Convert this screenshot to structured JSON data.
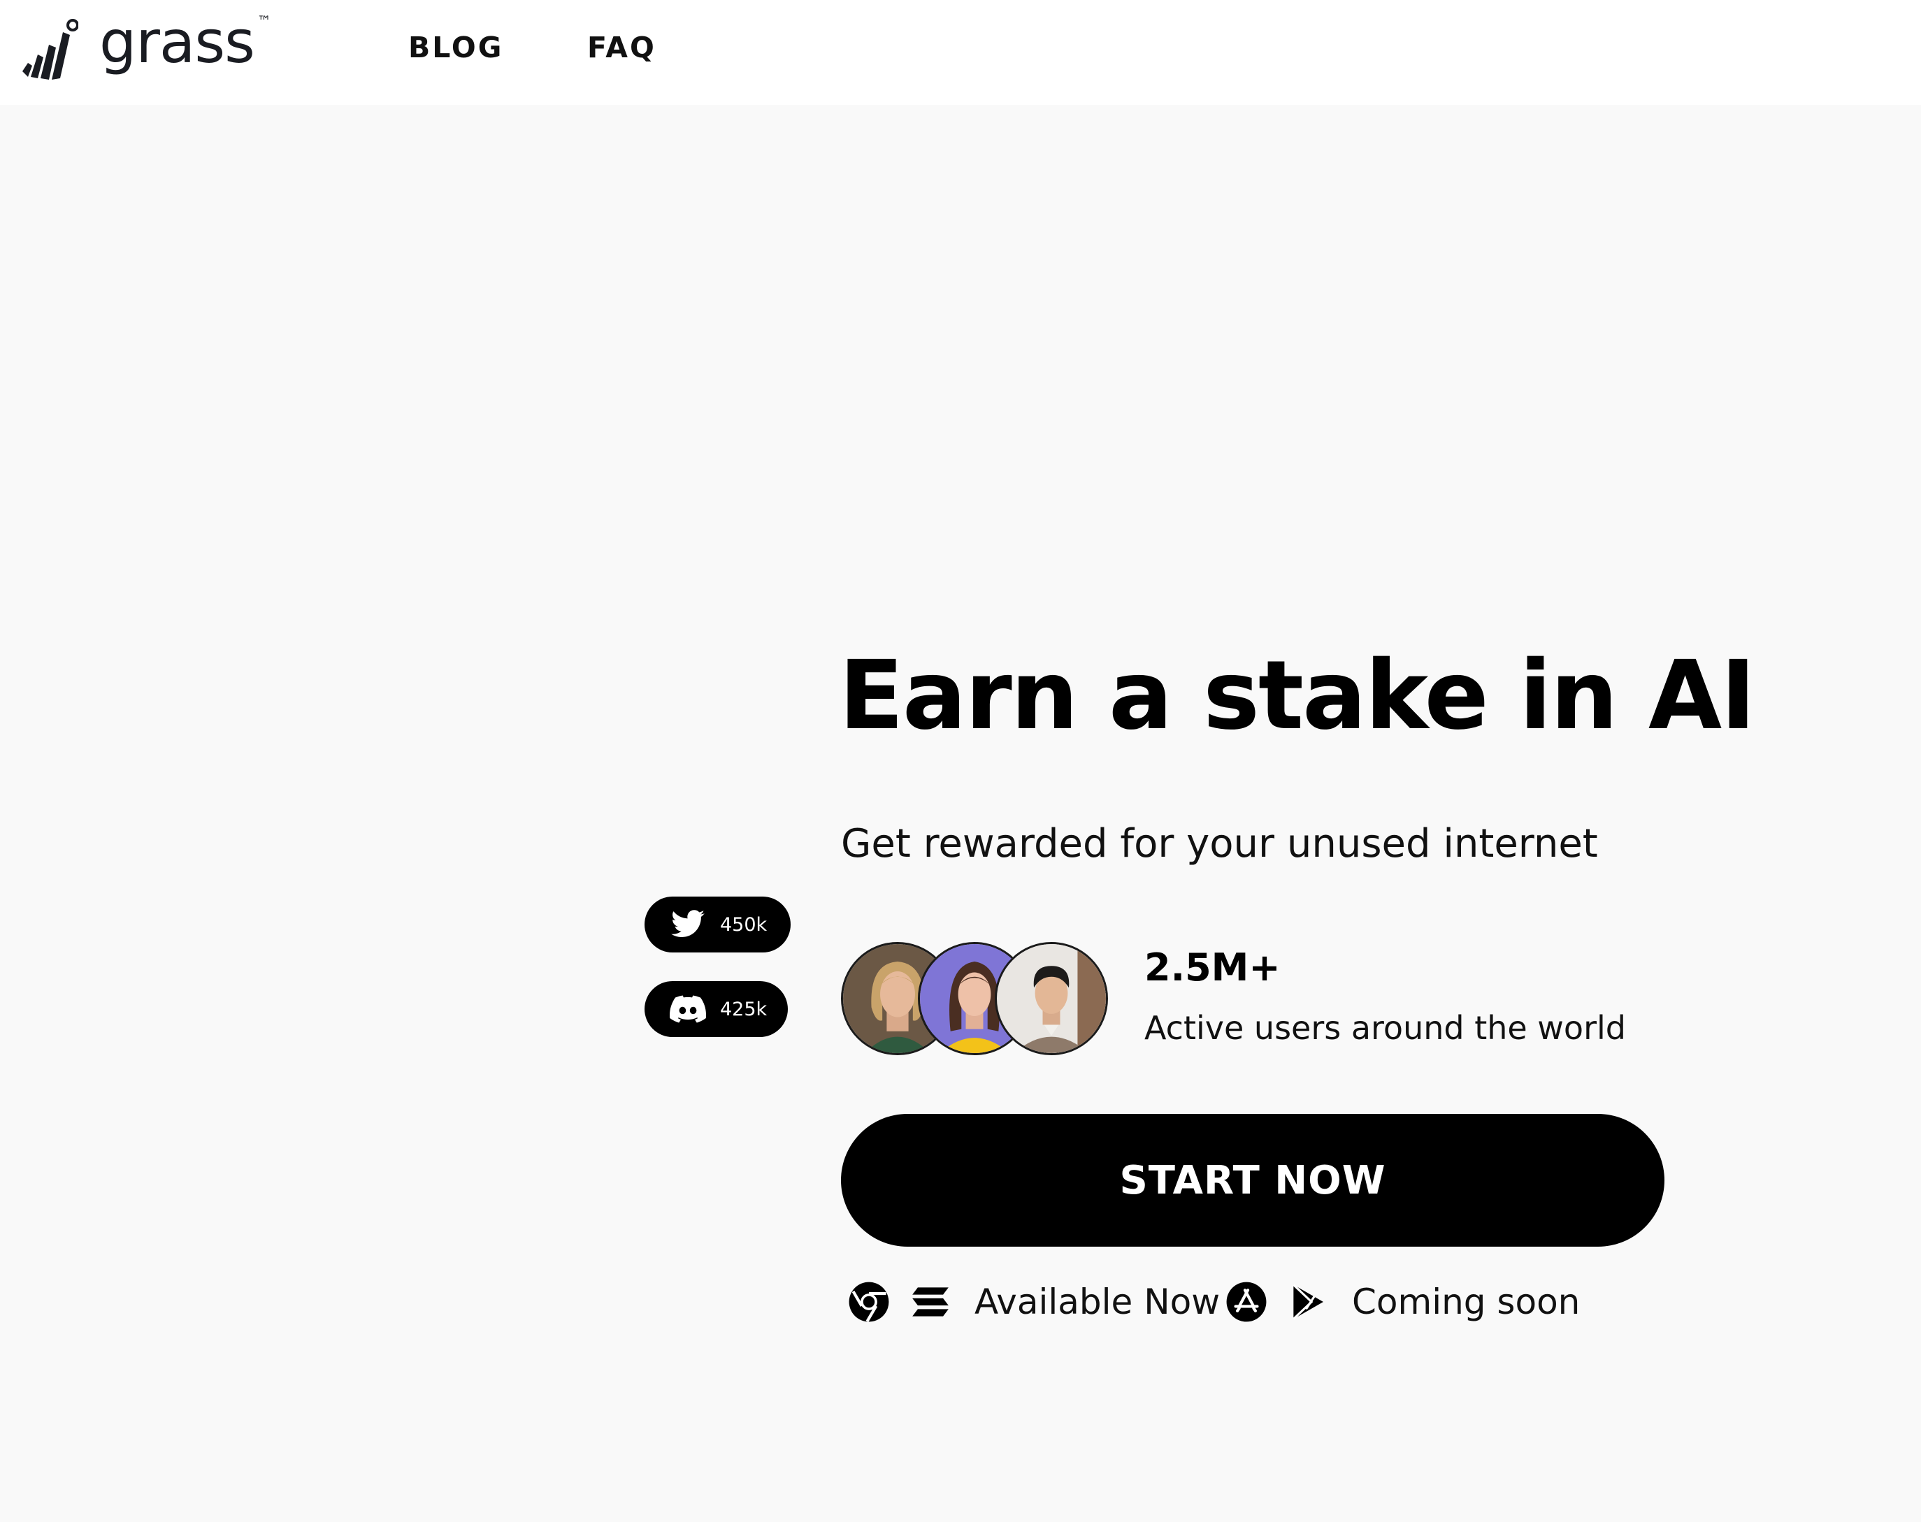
{
  "header": {
    "logo_text": "grass",
    "logo_tm": "™",
    "nav": [
      {
        "label": "BLOG"
      },
      {
        "label": "FAQ"
      }
    ]
  },
  "social": {
    "twitter": {
      "icon": "twitter-icon",
      "count": "450k"
    },
    "discord": {
      "icon": "discord-icon",
      "count": "425k"
    }
  },
  "hero": {
    "title": "Earn a stake in AI",
    "subtitle": "Get rewarded for your unused internet",
    "stat_value": "2.5M+",
    "stat_label": "Active users around the world",
    "cta_label": "START NOW",
    "available": {
      "icons": [
        "chrome-icon",
        "solana-icon"
      ],
      "label": "Available Now"
    },
    "coming_soon": {
      "icons": [
        "app-store-icon",
        "google-play-icon"
      ],
      "label": "Coming soon"
    }
  },
  "colors": {
    "page_background": "#f9f9f9",
    "header_background": "#ffffff",
    "primary": "#000000",
    "avatar_bg_1": "#5a4a3a",
    "avatar_bg_2": "#7f75d6",
    "avatar_bg_3": "#e9e6e2"
  }
}
